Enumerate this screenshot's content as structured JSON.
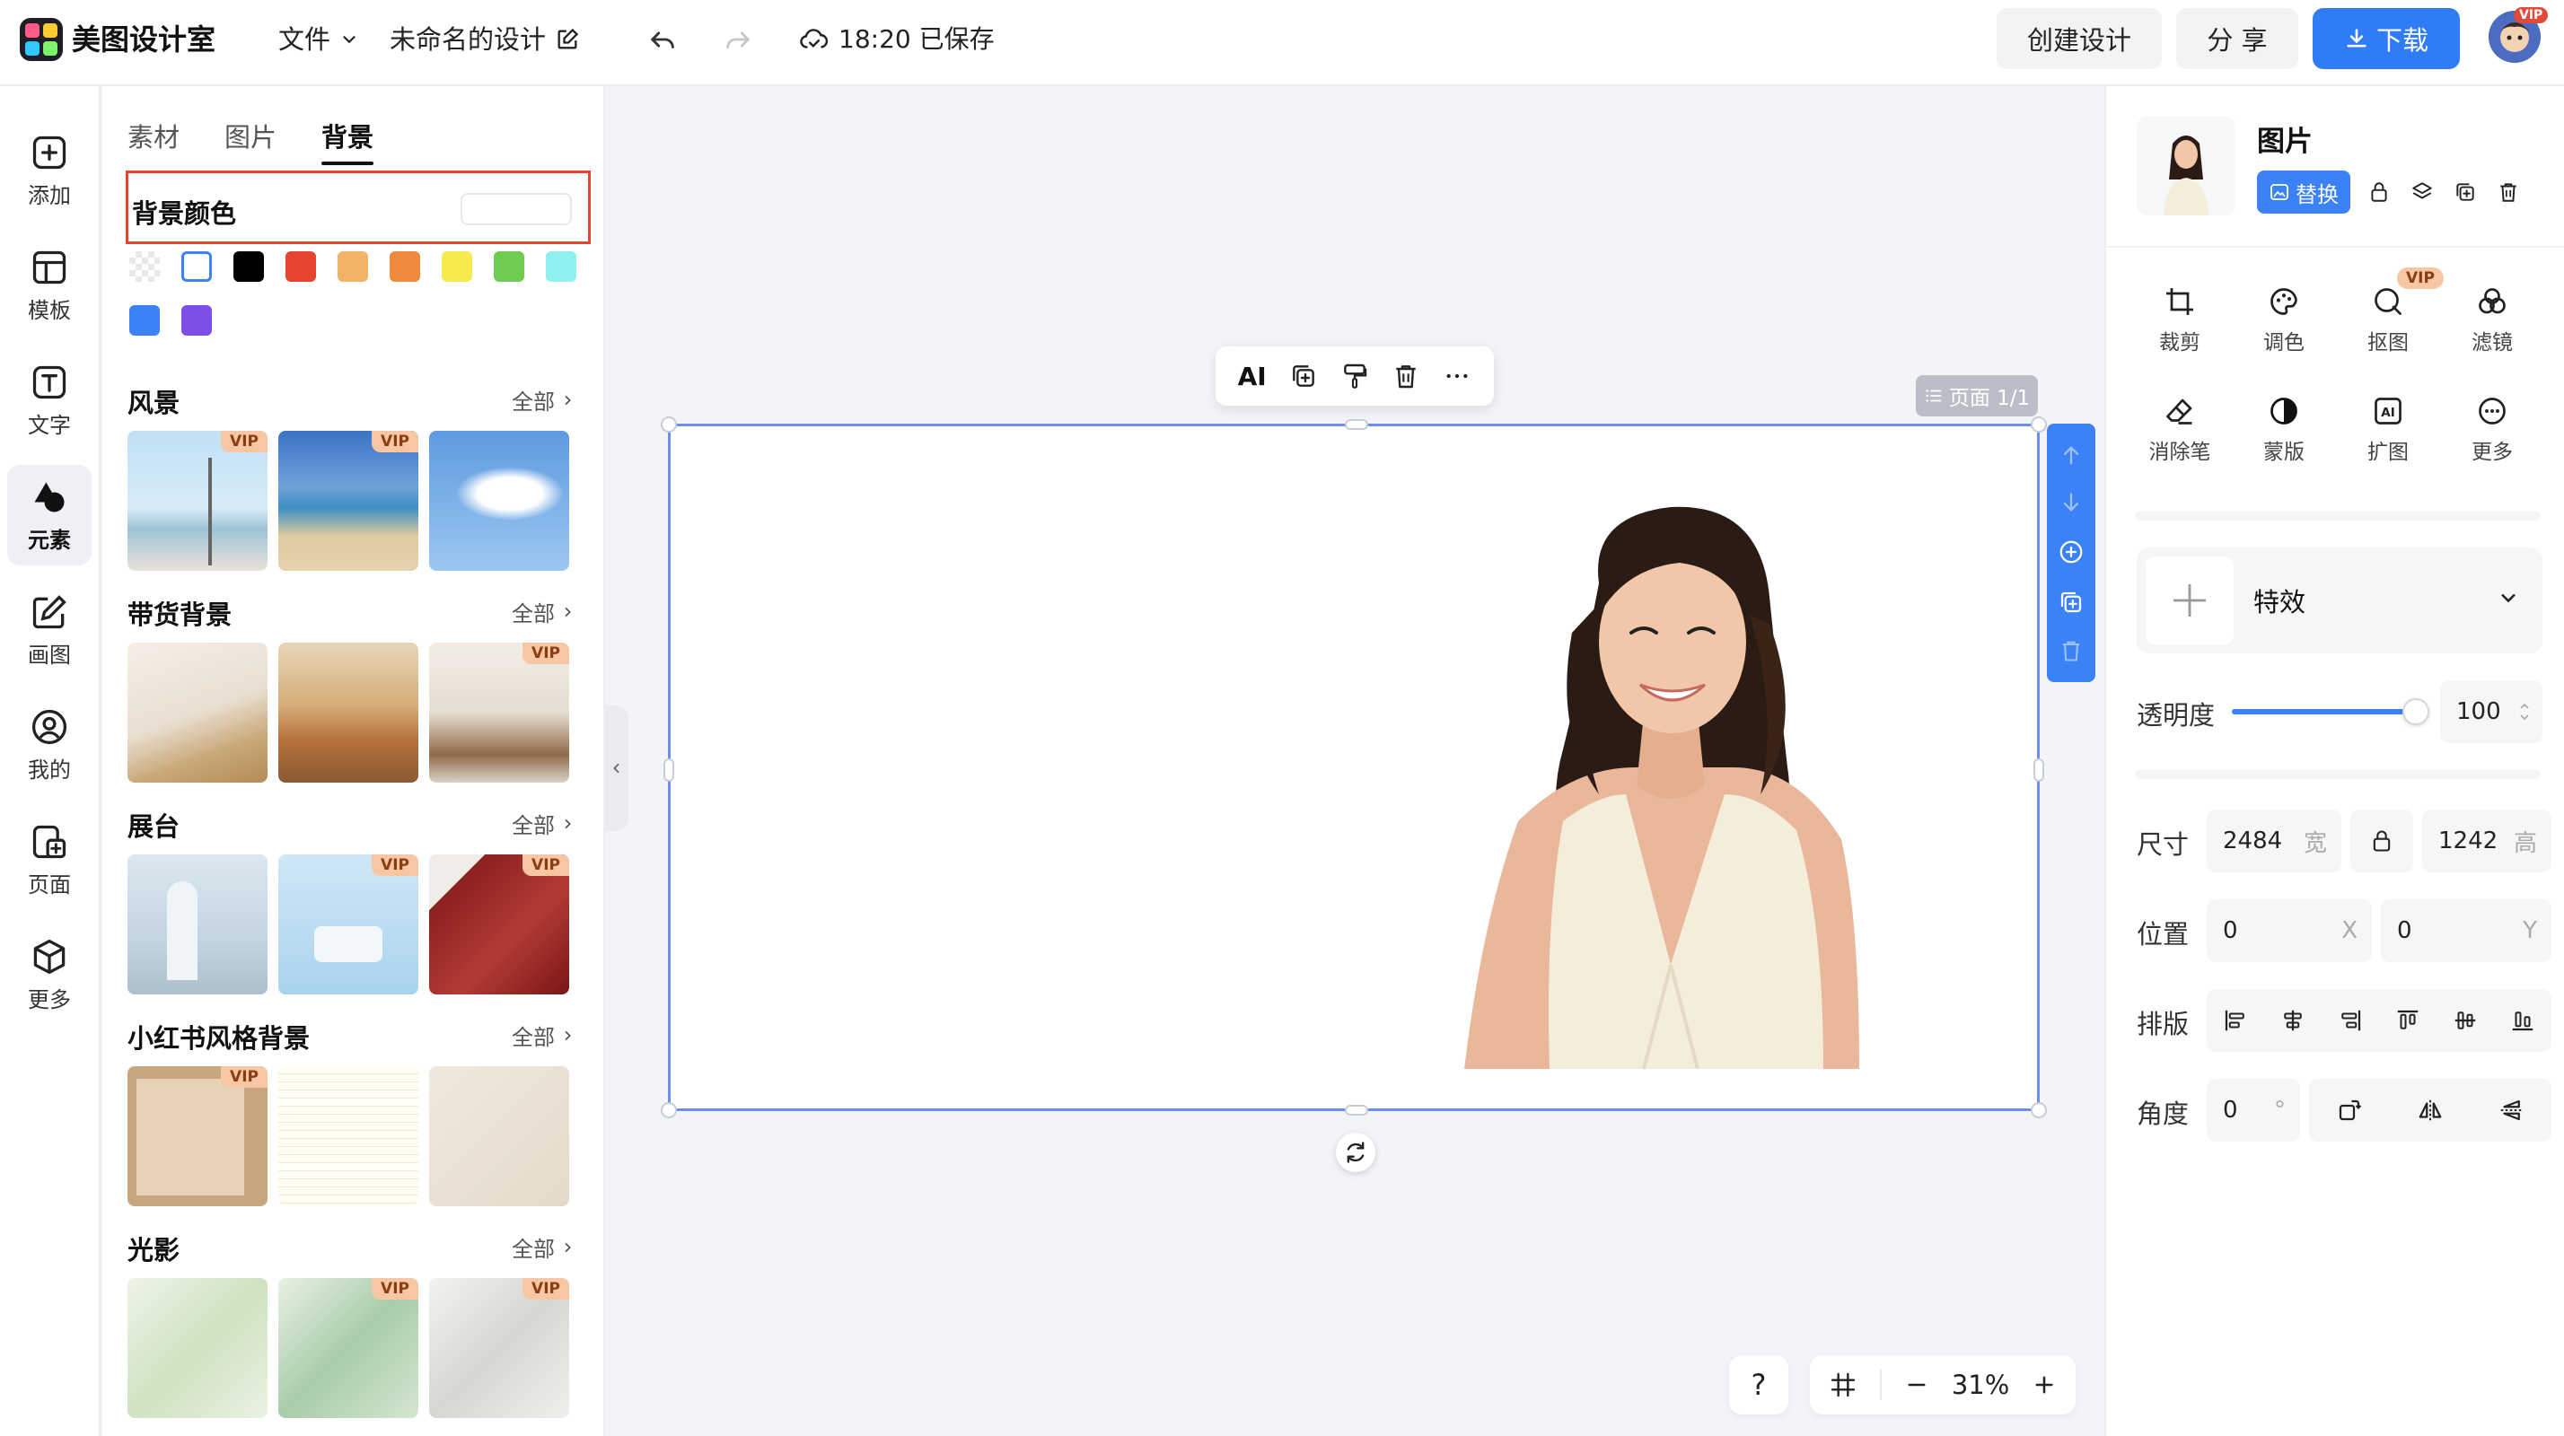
{
  "app": {
    "title": "美图设计室",
    "file_menu": "文件",
    "design_name": "未命名的设计",
    "saved_status": "18:20 已保存"
  },
  "topbar": {
    "create_label": "创建设计",
    "share_label": "分 享",
    "download_label": "下载",
    "avatar_badge": "VIP"
  },
  "rail": [
    {
      "label": "添加",
      "icon": "add-icon"
    },
    {
      "label": "模板",
      "icon": "template-icon"
    },
    {
      "label": "文字",
      "icon": "text-icon"
    },
    {
      "label": "元素",
      "icon": "shapes-icon",
      "active": true
    },
    {
      "label": "画图",
      "icon": "draw-icon"
    },
    {
      "label": "我的",
      "icon": "user-icon"
    },
    {
      "label": "页面",
      "icon": "page-icon"
    },
    {
      "label": "更多",
      "icon": "cube-icon"
    }
  ],
  "panel": {
    "tabs": [
      {
        "label": "素材"
      },
      {
        "label": "图片"
      },
      {
        "label": "背景",
        "active": true
      }
    ],
    "bg_color_label": "背景颜色",
    "swatches": [
      "transparent",
      "#ffffff",
      "#000000",
      "#e5452f",
      "#f2b366",
      "#ef8a3c",
      "#f6ea4f",
      "#6fcc52",
      "#8ff0ef",
      "#3b82f6",
      "#7b4fe8"
    ],
    "vip_label": "VIP",
    "sections": [
      {
        "title": "风景",
        "all": "全部",
        "vip": [
          true,
          true,
          false
        ]
      },
      {
        "title": "带货背景",
        "all": "全部",
        "vip": [
          false,
          false,
          true
        ]
      },
      {
        "title": "展台",
        "all": "全部",
        "vip": [
          false,
          true,
          true
        ]
      },
      {
        "title": "小红书风格背景",
        "all": "全部",
        "vip": [
          true,
          false,
          false
        ]
      },
      {
        "title": "光影",
        "all": "全部",
        "vip": [
          false,
          true,
          true
        ]
      }
    ]
  },
  "canvas": {
    "ai_label": "AI",
    "page_label": "页面 1/1",
    "help_label": "?",
    "zoom": "31%"
  },
  "props": {
    "title": "图片",
    "replace_label": "替换",
    "tools": [
      {
        "label": "裁剪",
        "icon": "crop-icon"
      },
      {
        "label": "调色",
        "icon": "palette-icon"
      },
      {
        "label": "抠图",
        "icon": "cutout-icon",
        "vip": true
      },
      {
        "label": "滤镜",
        "icon": "filter-icon"
      },
      {
        "label": "消除笔",
        "icon": "eraser-icon"
      },
      {
        "label": "蒙版",
        "icon": "mask-icon"
      },
      {
        "label": "扩图",
        "icon": "expand-icon"
      },
      {
        "label": "更多",
        "icon": "more-icon"
      }
    ],
    "vip_label": "VIP",
    "effects_label": "特效",
    "opacity_label": "透明度",
    "opacity_value": "100",
    "opacity": 1.0,
    "size_label": "尺寸",
    "width": "2484",
    "width_suffix": "宽",
    "height": "1242",
    "height_suffix": "高",
    "position_label": "位置",
    "pos_x": "0",
    "pos_x_suffix": "X",
    "pos_y": "0",
    "pos_y_suffix": "Y",
    "arrange_label": "排版",
    "angle_label": "角度",
    "angle": "0",
    "angle_suffix": "°"
  }
}
